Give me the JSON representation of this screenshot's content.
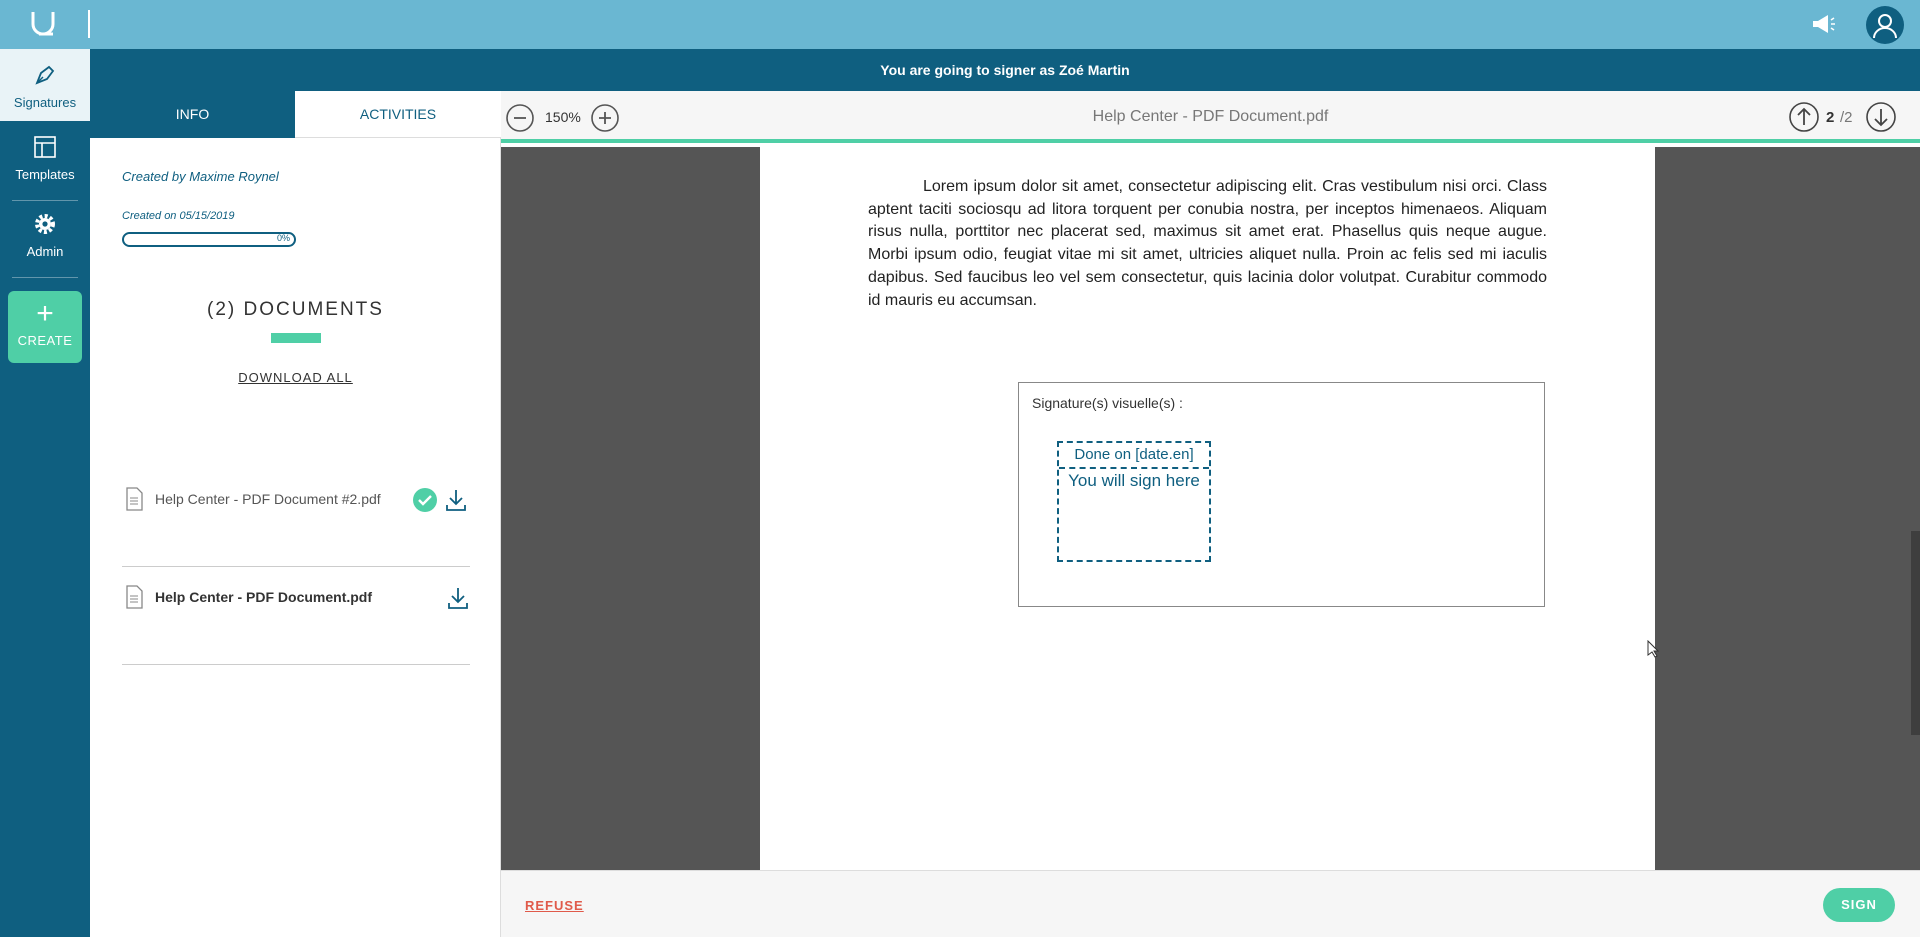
{
  "colors": {
    "topbar": "#6ab7d2",
    "primary": "#0f5f80",
    "accent": "#4fcfa6",
    "refuse": "#e05a4a",
    "viewer_bg": "#555555"
  },
  "topbar": {
    "logo_icon": "logo-icon",
    "notifications_icon": "megaphone-icon",
    "account_icon": "user-icon"
  },
  "nav": {
    "items": [
      {
        "label": "Signatures",
        "icon": "pen-icon",
        "active": true
      },
      {
        "label": "Templates",
        "icon": "template-icon",
        "active": false
      },
      {
        "label": "Admin",
        "icon": "gear-icon",
        "active": false
      }
    ],
    "create": {
      "label": "CREATE",
      "icon": "plus-icon"
    }
  },
  "banner": {
    "text": "You are going to signer as Zoé Martin"
  },
  "panel": {
    "tabs": [
      {
        "label": "INFO",
        "active": true
      },
      {
        "label": "ACTIVITIES",
        "active": false
      }
    ],
    "created_by": "Created by Maxime Roynel",
    "created_on": "Created on 05/15/2019",
    "progress": {
      "value": 0,
      "label": "0%"
    },
    "documents_title": "(2) DOCUMENTS",
    "download_all": "DOWNLOAD ALL",
    "documents": [
      {
        "name": "Help Center - PDF Document #2.pdf",
        "signed": true,
        "active": false
      },
      {
        "name": "Help Center - PDF Document.pdf",
        "signed": false,
        "active": true
      }
    ]
  },
  "viewer": {
    "zoom": "150%",
    "title": "Help Center - PDF Document.pdf",
    "page_current": "2",
    "page_total": "/2",
    "body_text": "Lorem ipsum dolor sit amet, consectetur adipiscing elit. Cras vestibulum nisi orci. Class aptent taciti sociosqu ad litora torquent per conubia nostra, per inceptos himenaeos. Aliquam risus nulla, porttitor nec placerat sed, maximus sit amet erat. Phasellus quis neque augue. Morbi ipsum odio, feugiat vitae mi sit amet, ultricies aliquet nulla. Proin ac felis sed mi iaculis dapibus. Sed faucibus leo vel sem consectetur, quis lacinia dolor volutpat. Curabitur commodo id mauris eu accumsan.",
    "signature_label": "Signature(s) visuelle(s) :",
    "signature_date": "Done on [date.en]",
    "signature_placeholder": "You will sign here"
  },
  "footer": {
    "refuse": "REFUSE",
    "sign": "SIGN"
  }
}
